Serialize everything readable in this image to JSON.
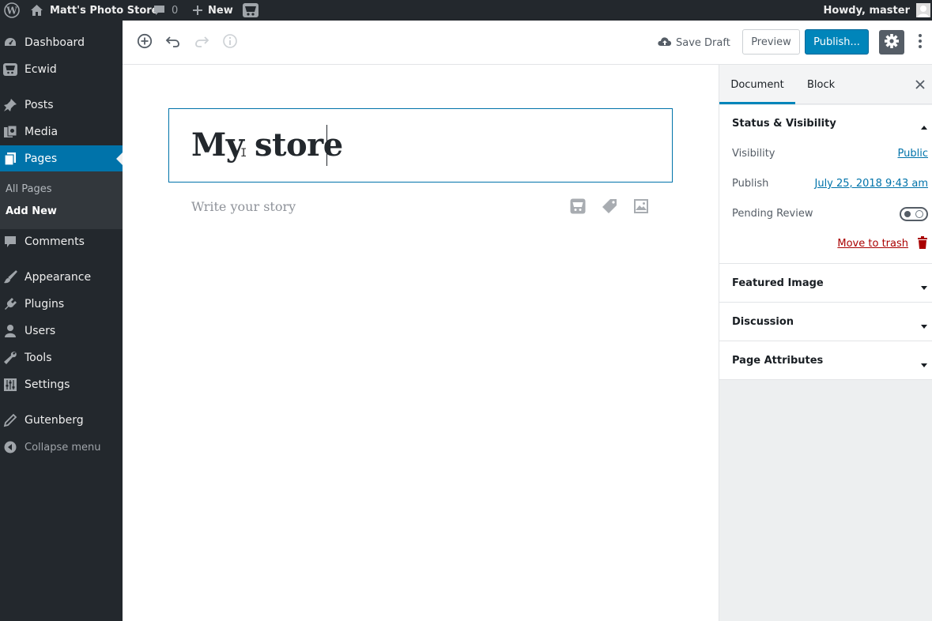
{
  "admin_bar": {
    "site_name": "Matt's Photo Store",
    "comments_count": "0",
    "new_label": "New",
    "howdy": "Howdy, master"
  },
  "side_menu": {
    "items": [
      {
        "label": "Dashboard",
        "icon": "dashboard-icon"
      },
      {
        "label": "Ecwid",
        "icon": "ecwid-cart-icon"
      },
      {
        "label": "Posts",
        "icon": "pushpin-icon"
      },
      {
        "label": "Media",
        "icon": "media-icon"
      },
      {
        "label": "Pages",
        "icon": "pages-icon",
        "active": true
      },
      {
        "label": "Comments",
        "icon": "comment-icon"
      },
      {
        "label": "Appearance",
        "icon": "brush-icon"
      },
      {
        "label": "Plugins",
        "icon": "plugin-icon"
      },
      {
        "label": "Users",
        "icon": "user-icon"
      },
      {
        "label": "Tools",
        "icon": "wrench-icon"
      },
      {
        "label": "Settings",
        "icon": "settings-sliders-icon"
      },
      {
        "label": "Gutenberg",
        "icon": "pencil-icon"
      }
    ],
    "submenu": {
      "all_pages": "All Pages",
      "add_new": "Add New"
    },
    "collapse_label": "Collapse menu"
  },
  "toolbar": {
    "save_draft": "Save Draft",
    "preview": "Preview",
    "publish": "Publish..."
  },
  "editor": {
    "title": "My store",
    "body_placeholder": "Write your story"
  },
  "sidebar": {
    "tabs": [
      "Document",
      "Block"
    ],
    "active_tab": "Document",
    "status_visibility": {
      "title": "Status & Visibility",
      "visibility_label": "Visibility",
      "visibility_value": "Public",
      "publish_label": "Publish",
      "publish_value": "July 25, 2018 9:43 am",
      "pending_label": "Pending Review",
      "pending_on": false,
      "trash_label": "Move to trash"
    },
    "panels": [
      "Featured Image",
      "Discussion",
      "Page Attributes"
    ]
  },
  "colors": {
    "admin_dark": "#23282d",
    "accent_blue": "#0073aa",
    "publish_blue": "#0085ba",
    "trash_red": "#a00"
  }
}
